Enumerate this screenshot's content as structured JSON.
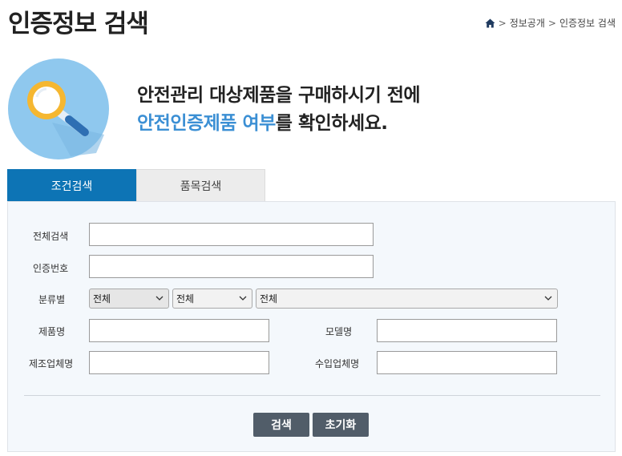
{
  "page": {
    "title": "인증정보 검색"
  },
  "breadcrumb": {
    "items": [
      "정보공개",
      "인증정보 검색"
    ],
    "separator": ">"
  },
  "hero": {
    "line1": "안전관리 대상제품을 구매하시기 전에",
    "line2_accent": "안전인증제품 여부",
    "line2_rest": "를 확인하세요.",
    "accent_color": "#3b8fd4"
  },
  "tabs": [
    {
      "label": "조건검색",
      "active": true
    },
    {
      "label": "품목검색",
      "active": false
    }
  ],
  "form": {
    "all_search": {
      "label": "전체검색",
      "value": ""
    },
    "cert_number": {
      "label": "인증번호",
      "value": ""
    },
    "category": {
      "label": "분류별",
      "select1": "전체",
      "select2": "전체",
      "select3": "전체"
    },
    "product_name": {
      "label": "제품명",
      "value": ""
    },
    "model_name": {
      "label": "모델명",
      "value": ""
    },
    "manufacturer": {
      "label": "제조업체명",
      "value": ""
    },
    "importer": {
      "label": "수입업체명",
      "value": ""
    }
  },
  "buttons": {
    "search": "검색",
    "reset": "초기화"
  },
  "colors": {
    "primary_tab": "#0d74b5",
    "button": "#515d69",
    "panel_bg": "#f4f8fc"
  }
}
